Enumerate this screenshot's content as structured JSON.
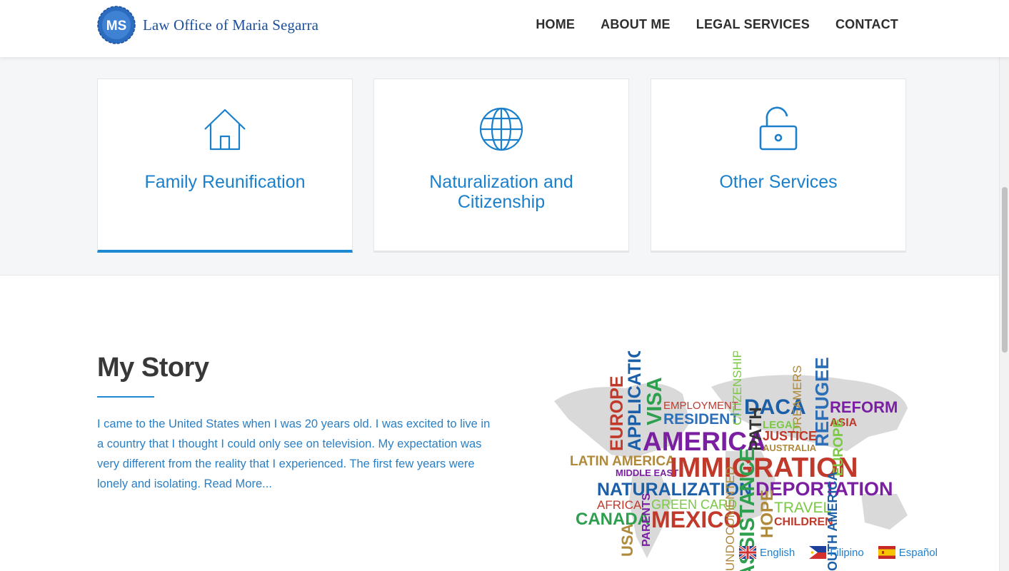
{
  "header": {
    "logo_initials": "MS",
    "site_title": "Law Office of Maria Segarra",
    "nav": [
      "HOME",
      "ABOUT ME",
      "LEGAL SERVICES",
      "CONTACT"
    ]
  },
  "services": [
    {
      "title": "Family Reunification",
      "icon": "house-icon",
      "active": true
    },
    {
      "title": "Naturalization and Citizenship",
      "icon": "globe-icon",
      "active": false
    },
    {
      "title": "Other Services",
      "icon": "unlock-icon",
      "active": false
    }
  ],
  "story": {
    "title": "My Story",
    "body": "I came to the United States when I was 20 years old. I was excited to live in a country that I thought I could only see on television. My expectation was very different from the reality that I experienced. The first few years were lonely and isolating.",
    "read_more": "Read More..."
  },
  "word_cloud": {
    "words": [
      "EMPLOYMENT",
      "RESIDENT",
      "CITIZENSHIP",
      "DACA",
      "DREAMERS",
      "REFUGEE",
      "REFORM",
      "ASIA",
      "EUROPE",
      "APPLICATION",
      "VISA",
      "AMERICA",
      "PATH",
      "LEGAL",
      "JUSTICE",
      "AUSTRALIA",
      "LATIN AMERICA",
      "MIDDLE EAST",
      "IMMIGRATION",
      "NATURALIZATION",
      "DEPORTATION",
      "AFRICA",
      "GREEN CARD",
      "TRAVEL",
      "CANADA",
      "MEXICO",
      "PARENTS",
      "UNDOCUMENTED",
      "ASSISTANCE",
      "HOPE",
      "CHILDREN",
      "USA",
      "SOUTH AMERICA"
    ]
  },
  "languages": [
    {
      "label": "English",
      "flag": "uk-flag-icon"
    },
    {
      "label": "Filipino",
      "flag": "philippines-flag-icon"
    },
    {
      "label": "Español",
      "flag": "spain-flag-icon"
    }
  ],
  "colors": {
    "accent": "#1e88d3",
    "brand": "#1b4f9c",
    "link": "#2a7fc4"
  }
}
